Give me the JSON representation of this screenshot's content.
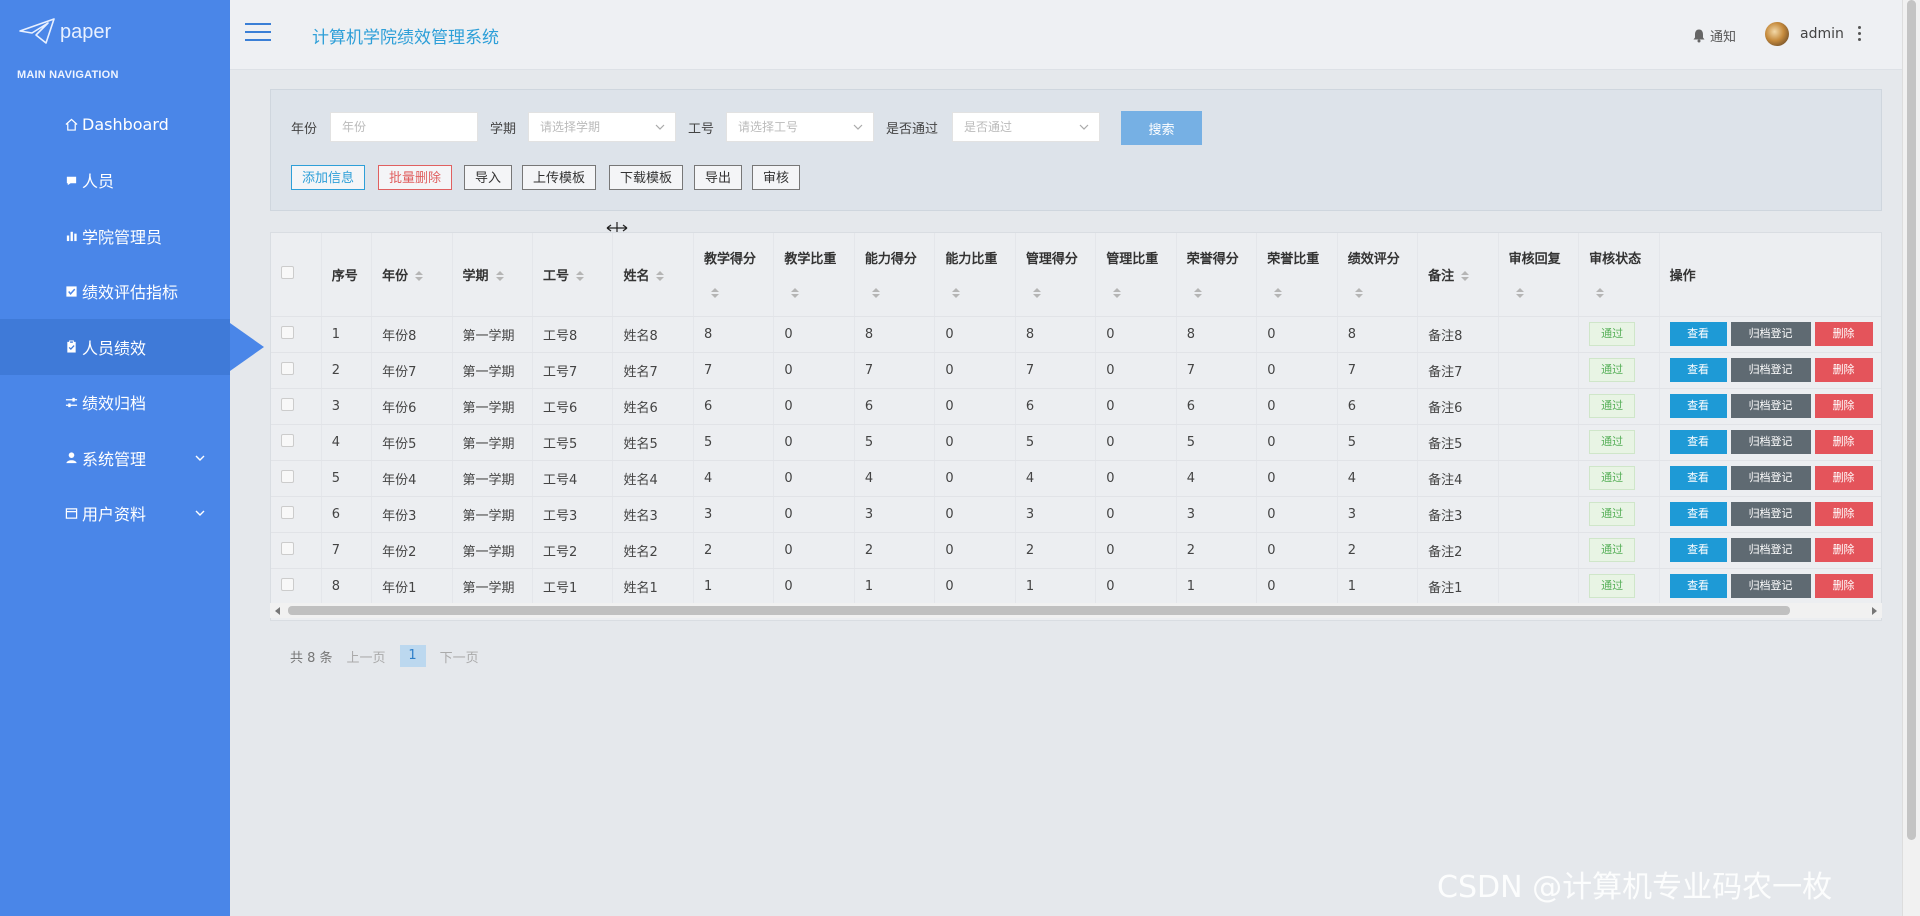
{
  "sidebar": {
    "logo_text": "paper",
    "heading": "MAIN NAVIGATION",
    "items": [
      {
        "label": "Dashboard",
        "icon": "home-icon"
      },
      {
        "label": "人员",
        "icon": "chat-icon"
      },
      {
        "label": "学院管理员",
        "icon": "bar-chart-icon"
      },
      {
        "label": "绩效评估指标",
        "icon": "checkbox-icon"
      },
      {
        "label": "人员绩效",
        "icon": "clipboard-icon"
      },
      {
        "label": "绩效归档",
        "icon": "sliders-icon"
      },
      {
        "label": "系统管理",
        "icon": "user-icon"
      },
      {
        "label": "用户资料",
        "icon": "window-icon"
      }
    ]
  },
  "header": {
    "title": "计算机学院绩效管理系统",
    "notify": "通知",
    "user": "admin"
  },
  "filters": {
    "year_label": "年份",
    "year_placeholder": "年份",
    "term_label": "学期",
    "term_placeholder": "请选择学期",
    "id_label": "工号",
    "id_placeholder": "请选择工号",
    "pass_label": "是否通过",
    "pass_placeholder": "是否通过",
    "search": "搜索"
  },
  "toolbar": {
    "add": "添加信息",
    "batch_delete": "批量删除",
    "import": "导入",
    "upload_template": "上传模板",
    "download_template": "下载模板",
    "export": "导出",
    "audit": "审核"
  },
  "table": {
    "headers": [
      "序号",
      "年份",
      "学期",
      "工号",
      "姓名",
      "教学得分",
      "教学比重",
      "能力得分",
      "能力比重",
      "管理得分",
      "管理比重",
      "荣誉得分",
      "荣誉比重",
      "绩效评分",
      "备注",
      "审核回复",
      "审核状态",
      "操作"
    ],
    "rows": [
      [
        "1",
        "年份8",
        "第一学期",
        "工号8",
        "姓名8",
        "8",
        "0",
        "8",
        "0",
        "8",
        "0",
        "8",
        "0",
        "8",
        "备注8",
        "",
        "通过"
      ],
      [
        "2",
        "年份7",
        "第一学期",
        "工号7",
        "姓名7",
        "7",
        "0",
        "7",
        "0",
        "7",
        "0",
        "7",
        "0",
        "7",
        "备注7",
        "",
        "通过"
      ],
      [
        "3",
        "年份6",
        "第一学期",
        "工号6",
        "姓名6",
        "6",
        "0",
        "6",
        "0",
        "6",
        "0",
        "6",
        "0",
        "6",
        "备注6",
        "",
        "通过"
      ],
      [
        "4",
        "年份5",
        "第一学期",
        "工号5",
        "姓名5",
        "5",
        "0",
        "5",
        "0",
        "5",
        "0",
        "5",
        "0",
        "5",
        "备注5",
        "",
        "通过"
      ],
      [
        "5",
        "年份4",
        "第一学期",
        "工号4",
        "姓名4",
        "4",
        "0",
        "4",
        "0",
        "4",
        "0",
        "4",
        "0",
        "4",
        "备注4",
        "",
        "通过"
      ],
      [
        "6",
        "年份3",
        "第一学期",
        "工号3",
        "姓名3",
        "3",
        "0",
        "3",
        "0",
        "3",
        "0",
        "3",
        "0",
        "3",
        "备注3",
        "",
        "通过"
      ],
      [
        "7",
        "年份2",
        "第一学期",
        "工号2",
        "姓名2",
        "2",
        "0",
        "2",
        "0",
        "2",
        "0",
        "2",
        "0",
        "2",
        "备注2",
        "",
        "通过"
      ],
      [
        "8",
        "年份1",
        "第一学期",
        "工号1",
        "姓名1",
        "1",
        "0",
        "1",
        "0",
        "1",
        "0",
        "1",
        "0",
        "1",
        "备注1",
        "",
        "通过"
      ]
    ],
    "actions": {
      "view": "查看",
      "archive": "归档登记",
      "delete": "删除"
    }
  },
  "pagination": {
    "total": "共 8 条",
    "prev": "上一页",
    "current": "1",
    "next": "下一页"
  },
  "watermark": "CSDN @计算机专业码农一枚",
  "colors": {
    "sidebar": "#4a86e8",
    "accent": "#2e9fd8",
    "view_button": "#1e9ad6",
    "archive_button": "#5f6a72",
    "delete_button": "#e4545b",
    "pass_tag": "#58b05a"
  }
}
